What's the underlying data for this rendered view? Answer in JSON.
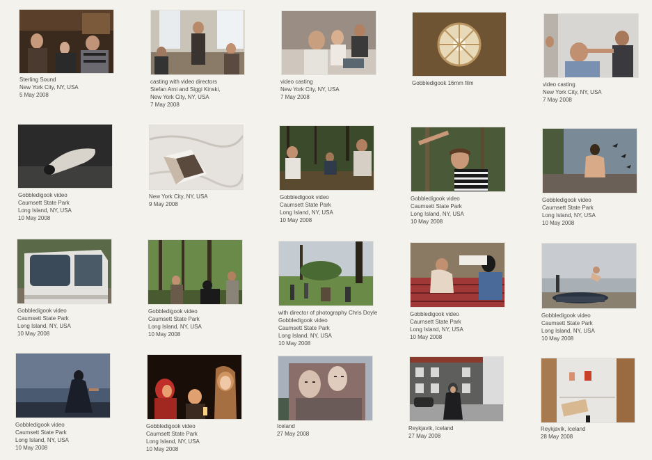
{
  "photos": [
    {
      "name": "photo-sterling-sound",
      "subject": "three people in a dark studio",
      "caption": [
        "Sterling Sound",
        "New York City, NY, USA",
        "5 May 2008"
      ]
    },
    {
      "name": "photo-casting-directors",
      "subject": "people in a bright room with windows",
      "caption": [
        "casting with video directors",
        "Stefan Arni and Siggi Kinski,",
        "New York City, NY, USA",
        "7 May 2008"
      ]
    },
    {
      "name": "photo-video-casting-1",
      "subject": "people at a table with a laptop",
      "caption": [
        "video casting",
        "New York City, NY, USA",
        "7 May 2008"
      ]
    },
    {
      "name": "photo-16mm-film",
      "subject": "round window on brown wall",
      "caption": [
        "Gobbledigook 16mm film"
      ]
    },
    {
      "name": "photo-video-casting-2",
      "subject": "people gathered around a boy",
      "caption": [
        "video casting",
        "New York City, NY, USA",
        "7 May 2008"
      ]
    },
    {
      "name": "photo-lying-figure",
      "subject": "person lying on dark ground",
      "caption": [
        "Gobbledigook video",
        "Caumsett State Park",
        "Long Island, NY, USA",
        "10 May 2008"
      ]
    },
    {
      "name": "photo-bed-book",
      "subject": "book open on white sheets",
      "caption": [
        "New York City, NY, USA",
        "9 May 2008"
      ]
    },
    {
      "name": "photo-forest-group",
      "subject": "people sitting in woods",
      "caption": [
        "Gobbledigook video",
        "Caumsett State Park",
        "Long Island, NY, USA",
        "10 May 2008"
      ]
    },
    {
      "name": "photo-striped-shirt",
      "subject": "young man in striped shirt in woods",
      "caption": [
        "Gobbledigook video",
        "Caumsett State Park",
        "Long Island, NY, USA",
        "10 May 2008"
      ]
    },
    {
      "name": "photo-shore-figure",
      "subject": "person by water on rocks",
      "caption": [
        "Gobbledigook video",
        "Caumsett State Park",
        "Long Island, NY, USA",
        "10 May 2008"
      ]
    },
    {
      "name": "photo-white-van",
      "subject": "white van in forest",
      "caption": [
        "Gobbledigook video",
        "Caumsett State Park",
        "Long Island, NY, USA",
        "10 May 2008"
      ]
    },
    {
      "name": "photo-forest-crew",
      "subject": "people standing in green forest",
      "caption": [
        "Gobbledigook video",
        "Caumsett State Park",
        "Long Island, NY, USA",
        "10 May 2008"
      ]
    },
    {
      "name": "photo-chris-doyle",
      "subject": "group in a park with trees",
      "caption": [
        "with director of photography Chris Doyle",
        "Gobbledigook video",
        "Caumsett State Park",
        "Long Island, NY, USA",
        "10 May 2008"
      ]
    },
    {
      "name": "photo-picnic-group",
      "subject": "people lying on blanket",
      "caption": [
        "Gobbledigook video",
        "Caumsett State Park",
        "Long Island, NY, USA",
        "10 May 2008"
      ]
    },
    {
      "name": "photo-trampoline",
      "subject": "figure jumping on beach",
      "caption": [
        "Gobbledigook video",
        "Caumsett State Park",
        "Long Island, NY, USA",
        "10 May 2008"
      ]
    },
    {
      "name": "photo-dusk-figure",
      "subject": "person on shore at dusk",
      "caption": [
        "Gobbledigook video",
        "Caumsett State Park",
        "Long Island, NY, USA",
        "10 May 2008"
      ]
    },
    {
      "name": "photo-fire-group",
      "subject": "faces lit by fire at night",
      "caption": [
        "Gobbledigook video",
        "Caumsett State Park",
        "Long Island, NY, USA",
        "10 May 2008"
      ]
    },
    {
      "name": "photo-iceland-mural",
      "subject": "large mural of faces on building",
      "caption": [
        "Iceland",
        "27 May 2008"
      ]
    },
    {
      "name": "photo-reykjavik-street",
      "subject": "woman on street before gray building",
      "caption": [
        "Reykjavik, Iceland",
        "27 May 2008"
      ]
    },
    {
      "name": "photo-reykjavik-room",
      "subject": "white room with objects on wall",
      "caption": [
        "Reykjavik, Iceland",
        "28 May 2008"
      ]
    }
  ]
}
